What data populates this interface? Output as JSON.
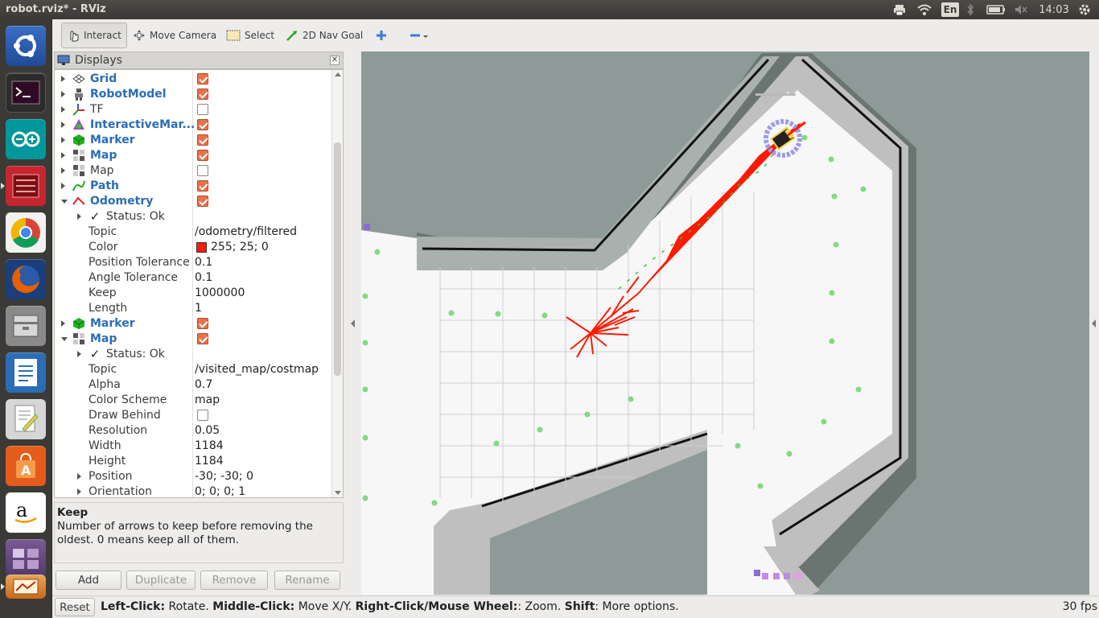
{
  "window": {
    "title": "robot.rviz* - RViz"
  },
  "tray": {
    "language": "En",
    "time": "14:03"
  },
  "launcher": {
    "items": [
      {
        "name": "ubuntu-dash",
        "color": "#dd4814"
      },
      {
        "name": "terminal",
        "color": "#2c2c2c"
      },
      {
        "name": "arduino",
        "color": "#00979c"
      },
      {
        "name": "system-monitor",
        "color": "#c6262e"
      },
      {
        "name": "chrome",
        "color": "#f2f2f2"
      },
      {
        "name": "firefox",
        "color": "#e66000"
      },
      {
        "name": "files",
        "color": "#7f7f7f"
      },
      {
        "name": "libreoffice-writer",
        "color": "#2a6db5"
      },
      {
        "name": "text-editor",
        "color": "#e2e2e2"
      },
      {
        "name": "software-center",
        "color": "#e55b1c"
      },
      {
        "name": "amazon",
        "color": "#ffffff"
      },
      {
        "name": "workspace-switcher",
        "color": "#6b4a86"
      }
    ]
  },
  "toolbar": {
    "interact": "Interact",
    "move_camera": "Move Camera",
    "select": "Select",
    "nav_goal": "2D Nav Goal"
  },
  "displays": {
    "title": "Displays",
    "rows": [
      {
        "name": "Grid",
        "bold": true,
        "check": true
      },
      {
        "name": "RobotModel",
        "bold": true,
        "check": true
      },
      {
        "name": "TF",
        "bold": false,
        "check": false
      },
      {
        "name": "InteractiveMar...",
        "bold": true,
        "check": true
      },
      {
        "name": "Marker",
        "bold": true,
        "check": true
      },
      {
        "name": "Map",
        "bold": true,
        "check": true
      },
      {
        "name": "Map",
        "bold": false,
        "check": false
      },
      {
        "name": "Path",
        "bold": true,
        "check": true
      },
      {
        "name": "Odometry",
        "bold": true,
        "check": true
      }
    ],
    "odometry": {
      "status": "Status: Ok",
      "topic_label": "Topic",
      "topic": "/odometry/filtered",
      "color_label": "Color",
      "color": "255; 25; 0",
      "color_swatch": "#ff1900",
      "pos_tol_label": "Position Tolerance",
      "pos_tol": "0.1",
      "ang_tol_label": "Angle Tolerance",
      "ang_tol": "0.1",
      "keep_label": "Keep",
      "keep": "1000000",
      "length_label": "Length",
      "length": "1"
    },
    "marker2": {
      "name": "Marker",
      "check": true
    },
    "map2": {
      "name": "Map",
      "check": true,
      "status": "Status: Ok",
      "topic_label": "Topic",
      "topic": "/visited_map/costmap",
      "alpha_label": "Alpha",
      "alpha": "0.7",
      "scheme_label": "Color Scheme",
      "scheme": "map",
      "draw_behind_label": "Draw Behind",
      "resolution_label": "Resolution",
      "resolution": "0.05",
      "width_label": "Width",
      "width": "1184",
      "height_label": "Height",
      "height": "1184",
      "position_label": "Position",
      "position": "-30; -30; 0",
      "orientation_label": "Orientation",
      "orientation": "0; 0; 0; 1"
    }
  },
  "help": {
    "title": "Keep",
    "text": "Number of arrows to keep before removing the oldest. 0 means keep all of them."
  },
  "buttons": {
    "add": "Add",
    "duplicate": "Duplicate",
    "remove": "Remove",
    "rename": "Rename"
  },
  "status": {
    "reset": "Reset",
    "left_click": "Left-Click:",
    "left_click_desc": " Rotate. ",
    "middle_click": "Middle-Click:",
    "middle_click_desc": " Move X/Y. ",
    "right_click": "Right-Click/Mouse Wheel:",
    "right_click_desc": ": Zoom. ",
    "shift": "Shift",
    "shift_desc": ": More options.",
    "fps": "30 fps"
  },
  "colors": {
    "unknown": "#8d9a97",
    "free": "#f7f7f7",
    "inflation": "#bfbfbf",
    "wall_shade": "#6a7471",
    "path": "#ff1900",
    "marker": "#7fdc7f"
  }
}
